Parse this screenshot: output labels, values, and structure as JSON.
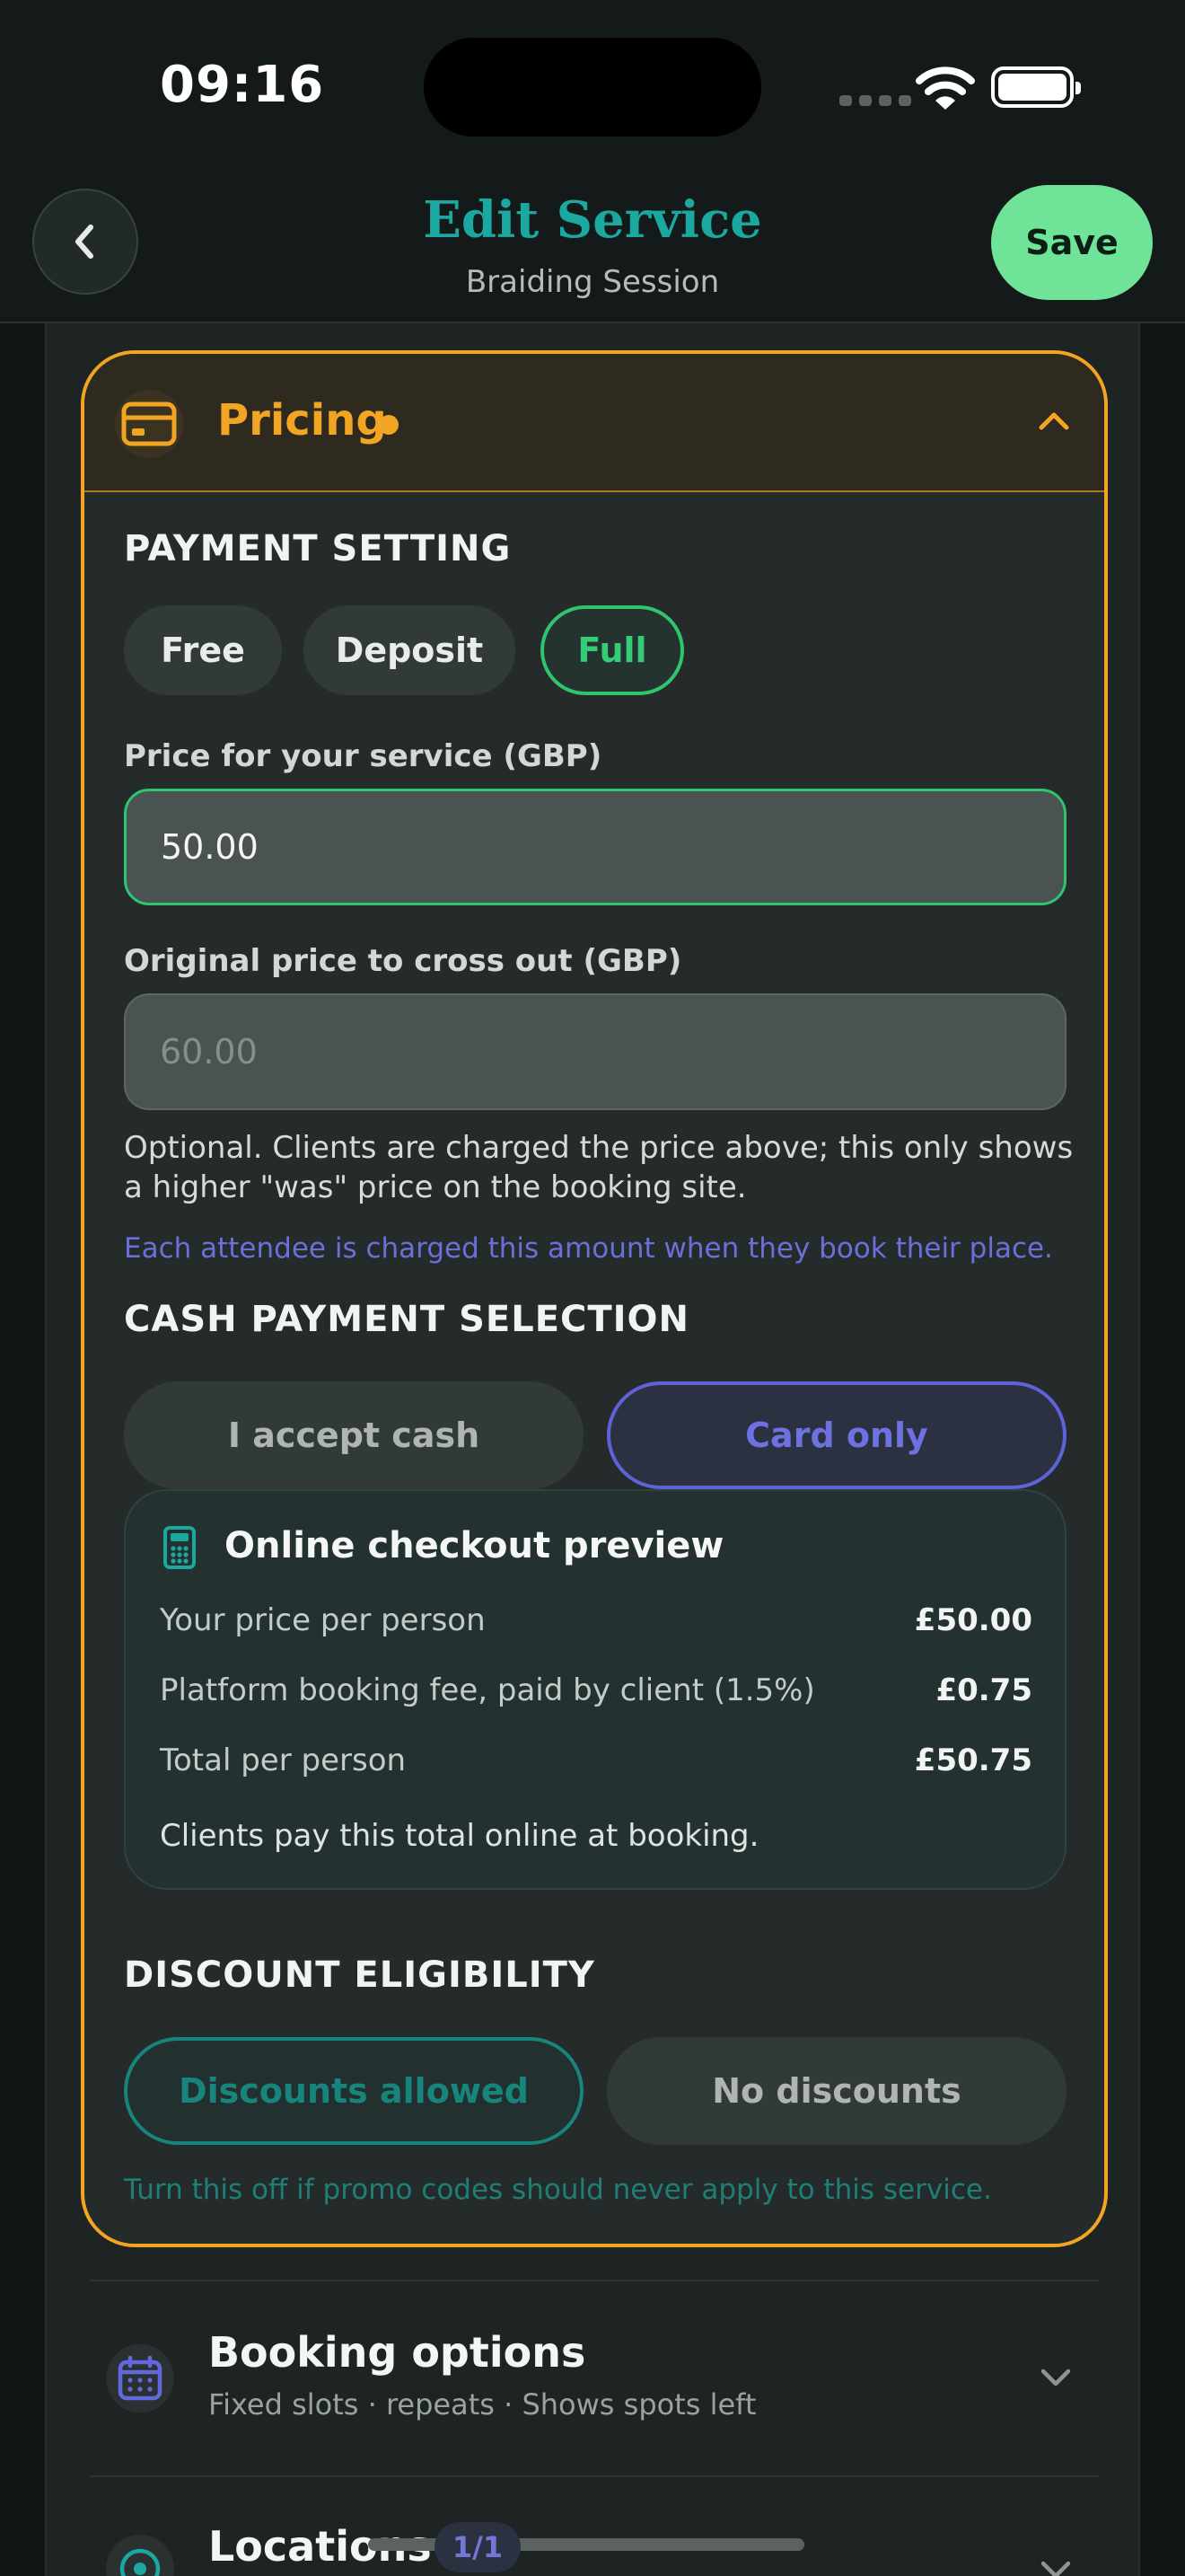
{
  "status_bar": {
    "time": "09:16"
  },
  "header": {
    "title": "Edit Service",
    "subtitle": "Braiding Session",
    "save_label": "Save"
  },
  "pricing": {
    "title": "Pricing",
    "accent_color": "#f2a423",
    "payment_setting": {
      "label": "PAYMENT SETTING",
      "options": [
        "Free",
        "Deposit",
        "Full"
      ],
      "selected": "Full"
    },
    "price_field": {
      "label": "Price for your service (GBP)",
      "value": "50.00"
    },
    "original_price_field": {
      "label": "Original price to cross out (GBP)",
      "placeholder": "60.00"
    },
    "original_price_help": "Optional. Clients are charged the price above; this only shows a higher \"was\" price on the booking site.",
    "attendee_note": "Each attendee is charged this amount when they book their place.",
    "cash_payment": {
      "label": "CASH PAYMENT SELECTION",
      "options": [
        "I accept cash",
        "Card only"
      ],
      "selected": "Card only"
    },
    "checkout_preview": {
      "title": "Online checkout preview",
      "rows": [
        {
          "label": "Your price per person",
          "value": "£50.00"
        },
        {
          "label": "Platform booking fee, paid by client (1.5%)",
          "value": "£0.75"
        },
        {
          "label": "Total per person",
          "value": "£50.75"
        }
      ],
      "note": "Clients pay this total online at booking."
    },
    "discount": {
      "label": "DISCOUNT ELIGIBILITY",
      "options": [
        "Discounts allowed",
        "No discounts"
      ],
      "selected": "Discounts allowed",
      "hint": "Turn this off if promo codes should never apply to this service."
    }
  },
  "sections": {
    "booking_options": {
      "title": "Booking options",
      "subtitle": "Fixed slots · repeats · Shows spots left"
    },
    "locations": {
      "title": "Locations"
    }
  },
  "page_indicator": "1/1"
}
